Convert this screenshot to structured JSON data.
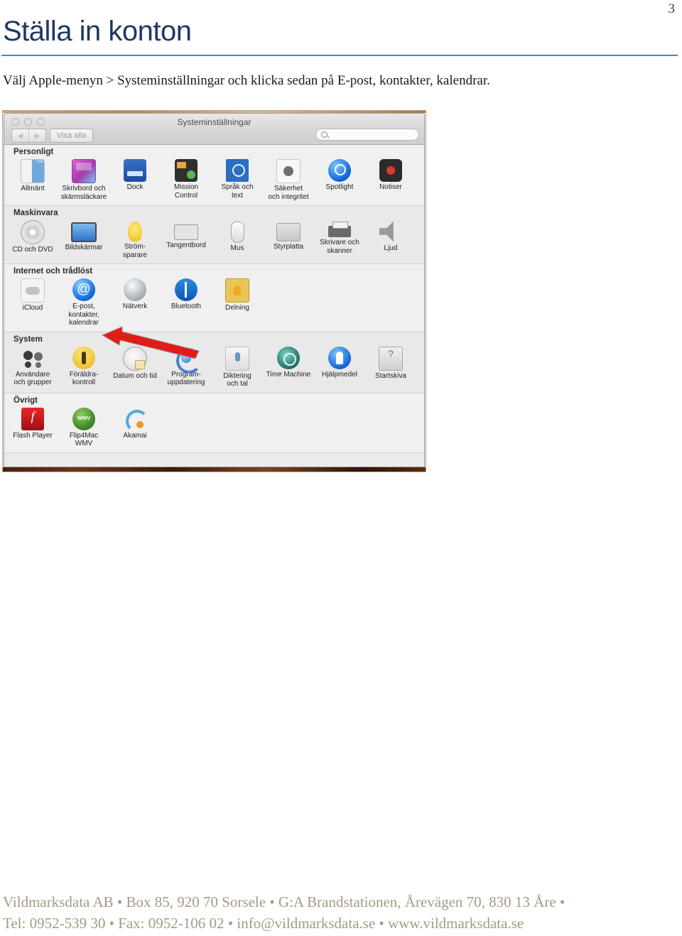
{
  "document": {
    "page_number": "3",
    "title": "Ställa in konton",
    "intro": "Välj Apple-menyn > Systeminställningar och klicka sedan på E-post, kontakter, kalendrar.",
    "title_color": "#1f3864",
    "rule_color": "#4f81bd",
    "footer_color": "#a59a85"
  },
  "screenshot": {
    "window": {
      "title": "Systeminställningar",
      "toolbar": {
        "back_icon": "◀",
        "forward_icon": "▶",
        "show_all_label": "Visa alla",
        "search_icon": "search-icon",
        "search_value": "",
        "search_placeholder": ""
      },
      "traffic_lights": [
        "close",
        "minimize",
        "zoom"
      ]
    },
    "sections": [
      {
        "label": "Personligt",
        "items": [
          {
            "label": "Allmänt",
            "icon": "general-icon"
          },
          {
            "label": "Skrivbord och\nskärmsläckare",
            "icon": "desktop-screensaver-icon"
          },
          {
            "label": "Dock",
            "icon": "dock-icon"
          },
          {
            "label": "Mission\nControl",
            "icon": "mission-control-icon"
          },
          {
            "label": "Språk och\ntext",
            "icon": "language-text-icon"
          },
          {
            "label": "Säkerhet\noch integritet",
            "icon": "security-privacy-icon"
          },
          {
            "label": "Spotlight",
            "icon": "spotlight-icon"
          },
          {
            "label": "Notiser",
            "icon": "notifications-icon"
          }
        ]
      },
      {
        "label": "Maskinvara",
        "items": [
          {
            "label": "CD och DVD",
            "icon": "cd-dvd-icon"
          },
          {
            "label": "Bildskärmar",
            "icon": "displays-icon"
          },
          {
            "label": "Ström-\nsparare",
            "icon": "energy-saver-icon"
          },
          {
            "label": "Tangentbord",
            "icon": "keyboard-icon"
          },
          {
            "label": "Mus",
            "icon": "mouse-icon"
          },
          {
            "label": "Styrplatta",
            "icon": "trackpad-icon"
          },
          {
            "label": "Skrivare och\nskanner",
            "icon": "printers-scanners-icon"
          },
          {
            "label": "Ljud",
            "icon": "sound-icon"
          }
        ]
      },
      {
        "label": "Internet och trådlöst",
        "items": [
          {
            "label": "iCloud",
            "icon": "icloud-icon"
          },
          {
            "label": "E-post, kontakter,\nkalendrar",
            "icon": "mail-contacts-calendars-icon"
          },
          {
            "label": "Nätverk",
            "icon": "network-icon"
          },
          {
            "label": "Bluetooth",
            "icon": "bluetooth-icon"
          },
          {
            "label": "Delning",
            "icon": "sharing-icon"
          }
        ]
      },
      {
        "label": "System",
        "items": [
          {
            "label": "Användare\noch grupper",
            "icon": "users-groups-icon"
          },
          {
            "label": "Föräldra-\nkontroll",
            "icon": "parental-controls-icon"
          },
          {
            "label": "Datum och tid",
            "icon": "date-time-icon"
          },
          {
            "label": "Program-\nuppdatering",
            "icon": "software-update-icon"
          },
          {
            "label": "Diktering\noch tal",
            "icon": "dictation-speech-icon"
          },
          {
            "label": "Time Machine",
            "icon": "time-machine-icon"
          },
          {
            "label": "Hjälpmedel",
            "icon": "accessibility-icon"
          },
          {
            "label": "Startskiva",
            "icon": "startup-disk-icon"
          }
        ]
      },
      {
        "label": "Övrigt",
        "items": [
          {
            "label": "Flash Player",
            "icon": "flash-player-icon"
          },
          {
            "label": "Flip4Mac\nWMV",
            "icon": "flip4mac-wmv-icon"
          },
          {
            "label": "Akamai",
            "icon": "akamai-icon"
          }
        ]
      }
    ],
    "annotation": {
      "type": "red-arrow",
      "color": "#e01b18",
      "points_to": "E-post, kontakter, kalendrar"
    }
  },
  "footer": {
    "line1": "Vildmarksdata AB • Box 85, 920 70 Sorsele • G:A Brandstationen, Årevägen 70, 830 13 Åre •",
    "line2": "Tel: 0952-539 30 • Fax: 0952-106 02 • info@vildmarksdata.se • www.vildmarksdata.se"
  }
}
